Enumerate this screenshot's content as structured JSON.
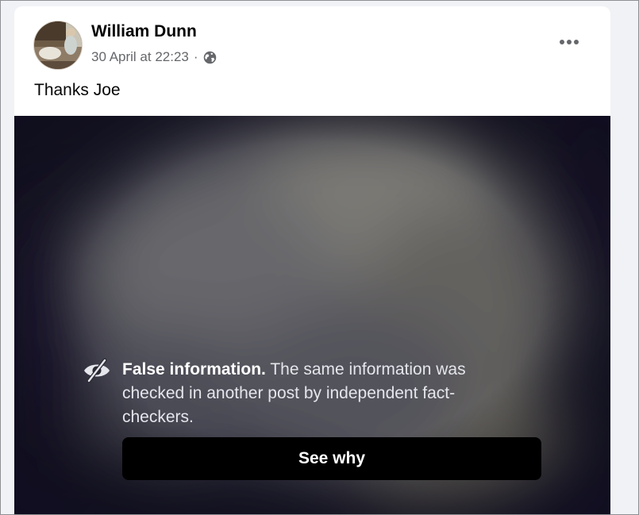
{
  "post": {
    "author_name": "William Dunn",
    "timestamp": "30 April at 22:23",
    "separator": "·",
    "privacy_icon": "globe-icon",
    "more_icon": "more-options-icon",
    "text": "Thanks Joe"
  },
  "fact_check": {
    "icon": "eye-slash-icon",
    "label": "False information.",
    "message": "The same information was checked in another post by independent fact-checkers.",
    "button_label": "See why"
  },
  "colors": {
    "page_background": "#f0f2f5",
    "card_background": "#ffffff",
    "secondary_text": "#65676b",
    "button_background": "#000000"
  }
}
